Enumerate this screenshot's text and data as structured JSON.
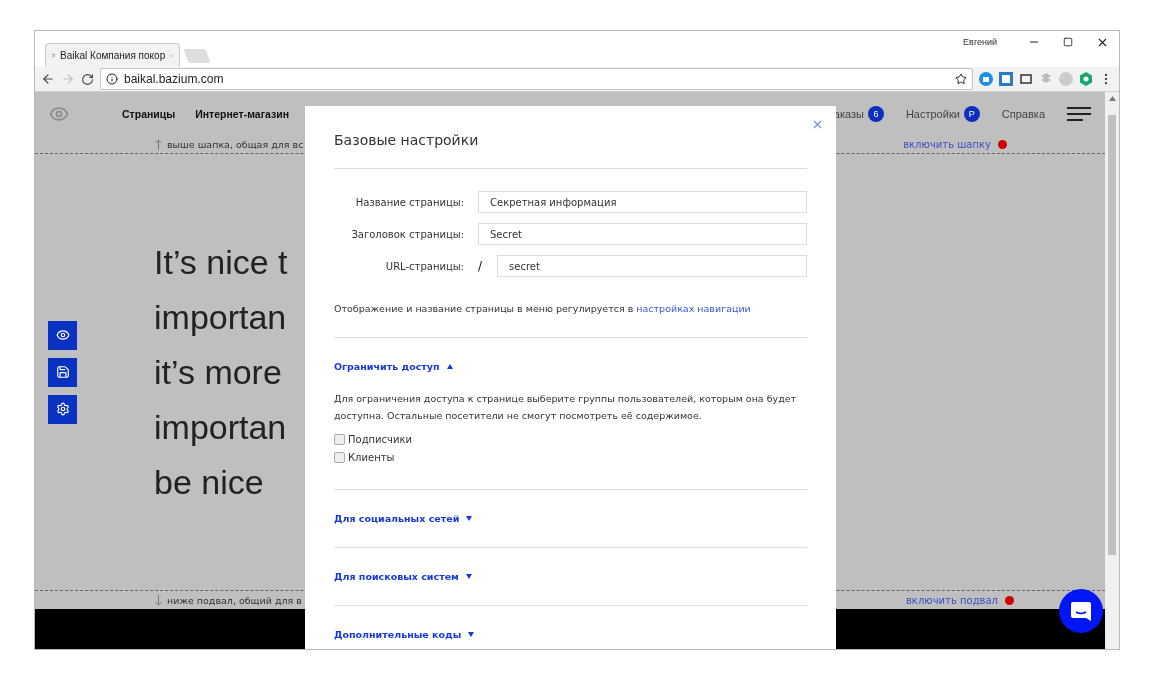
{
  "browser": {
    "tab_title": "Baikal Компания покор",
    "url": "baikal.bazium.com",
    "user": "Евгений"
  },
  "site_nav": {
    "items": [
      {
        "label": "Страницы"
      },
      {
        "label": "Интернет-магазин"
      }
    ],
    "right_items": [
      {
        "label": "аказы",
        "badge": "6"
      },
      {
        "label": "Настройки",
        "badge": "P"
      },
      {
        "label": "Справка"
      }
    ]
  },
  "header_strip": {
    "text": "выше шапка, общая для вс",
    "toggle": "включить шапку"
  },
  "hero_lines": [
    "It’s nice t",
    "importan",
    "it’s more",
    "importan",
    "be nice"
  ],
  "footer_strip": {
    "text": "ниже подвал, общий для в",
    "toggle": "включить подвал"
  },
  "modal": {
    "title": "Базовые настройки",
    "fields": [
      {
        "kind": "text",
        "label": "Название страницы:",
        "value": "Секретная информация"
      },
      {
        "kind": "text",
        "label": "Заголовок страницы:",
        "value": "Secret"
      },
      {
        "kind": "url",
        "label": "URL-страницы:",
        "prefix": "/",
        "value": "secret"
      }
    ],
    "note": {
      "text": "Отображение и название страницы в меню регулируется в",
      "link": "настройках навигации"
    },
    "sections": [
      {
        "title": "Ограничить доступ",
        "expanded": true,
        "description": "Для ограничения доступа к странице выберите группы пользователей, которым она будет доступна. Остальные посетители не смогут посмотреть её содержимое.",
        "options": [
          {
            "label": "Подписчики",
            "checked": false
          },
          {
            "label": "Клиенты",
            "checked": false
          }
        ]
      },
      {
        "title": "Для социальных сетей",
        "expanded": false
      },
      {
        "title": "Для поисковых систем",
        "expanded": false
      },
      {
        "title": "Дополнительные коды",
        "expanded": false
      }
    ]
  }
}
